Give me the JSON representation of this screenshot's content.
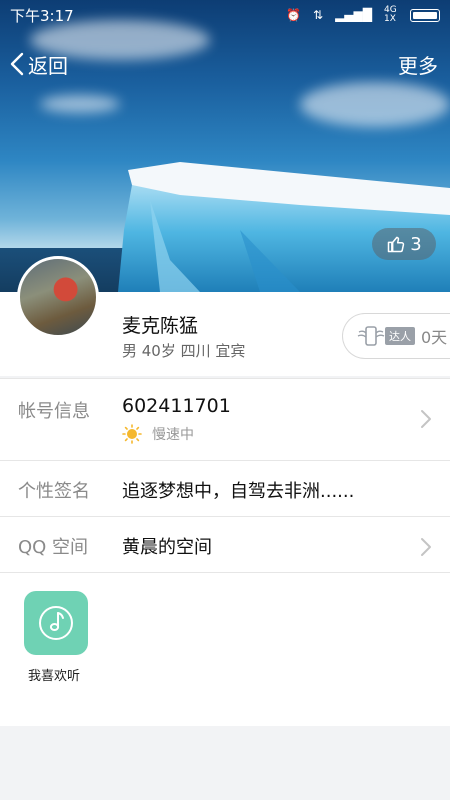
{
  "status_bar": {
    "time": "下午3:17",
    "network": "4G 1X"
  },
  "nav": {
    "back_label": "返回",
    "more_label": "更多"
  },
  "cover": {
    "likes": "3"
  },
  "profile": {
    "nickname": "麦克陈猛",
    "subinfo": "男 40岁 四川 宜宾",
    "daren_badge": "达人",
    "daren_days": "0天"
  },
  "account": {
    "label": "帐号信息",
    "qq_number": "602411701",
    "speed": "慢速中"
  },
  "signature": {
    "label": "个性签名",
    "text": "追逐梦想中，自驾去非洲......"
  },
  "qzone": {
    "label": "QQ 空间",
    "name": "黄晨的空间"
  },
  "apps": [
    {
      "label": "我喜欢听",
      "icon": "music-note-icon",
      "color": "#6fd2b4"
    }
  ]
}
